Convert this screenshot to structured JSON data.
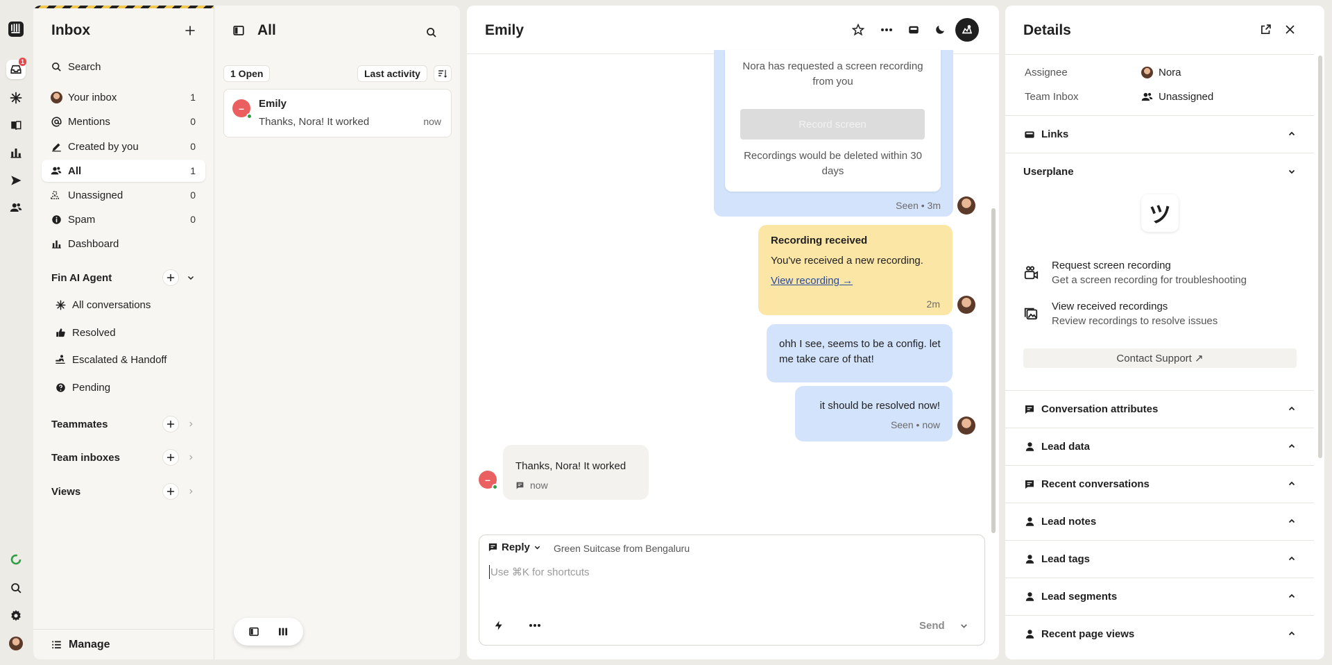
{
  "rail": {
    "inbox_badge": "1"
  },
  "sidebar": {
    "title": "Inbox",
    "search": "Search",
    "items": [
      {
        "label": "Your inbox",
        "count": "1"
      },
      {
        "label": "Mentions",
        "count": "0"
      },
      {
        "label": "Created by you",
        "count": "0"
      },
      {
        "label": "All",
        "count": "1"
      },
      {
        "label": "Unassigned",
        "count": "0"
      },
      {
        "label": "Spam",
        "count": "0"
      },
      {
        "label": "Dashboard",
        "count": ""
      }
    ],
    "fin_heading": "Fin AI Agent",
    "fin_items": [
      "All conversations",
      "Resolved",
      "Escalated & Handoff",
      "Pending"
    ],
    "teammates": "Teammates",
    "team_inboxes": "Team inboxes",
    "views": "Views",
    "manage": "Manage"
  },
  "list": {
    "title": "All",
    "open_filter": "1 Open",
    "sort": "Last activity",
    "conversation": {
      "name": "Emily",
      "preview": "Thanks, Nora! It worked",
      "time": "now",
      "initial": "–"
    }
  },
  "conversation": {
    "title": "Emily",
    "screen_request_text": "Nora has requested a screen recording from you",
    "record_button": "Record screen",
    "recordings_note": "Recordings would be deleted within 30 days",
    "seen_3m": "Seen • 3m",
    "recording_title": "Recording received",
    "recording_body": "You've received a new recording.",
    "recording_link": "View recording →",
    "recording_time": "2m",
    "msg1": "ohh I see, seems to be a config. let me take care of that!",
    "msg2": "it should be resolved now!",
    "msg2_meta": "Seen • now",
    "incoming_text": "Thanks, Nora! It worked",
    "incoming_time": "now",
    "composer": {
      "mode": "Reply",
      "subject": "Green Suitcase from Bengaluru",
      "placeholder": "Use ⌘K for shortcuts",
      "send": "Send"
    }
  },
  "details": {
    "title": "Details",
    "assignee_label": "Assignee",
    "assignee_value": "Nora",
    "team_label": "Team Inbox",
    "team_value": "Unassigned",
    "links": "Links",
    "userplane": "Userplane",
    "userplane_logo": "ツ",
    "actions": [
      {
        "title": "Request screen recording",
        "desc": "Get a screen recording for troubleshooting"
      },
      {
        "title": "View received recordings",
        "desc": "Review recordings to resolve issues"
      }
    ],
    "contact_support": "Contact Support ↗",
    "sections": [
      "Conversation attributes",
      "Lead data",
      "Recent conversations",
      "Lead notes",
      "Lead tags",
      "Lead segments",
      "Recent page views"
    ]
  }
}
